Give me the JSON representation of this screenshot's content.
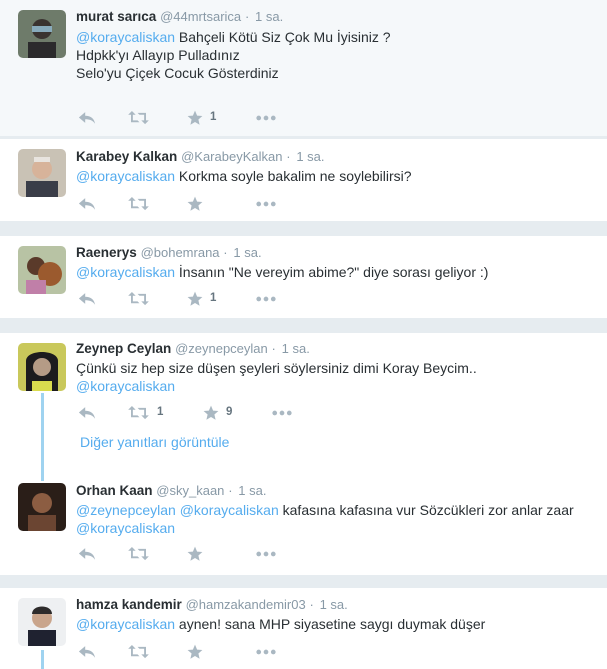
{
  "tweets": [
    {
      "name": "murat sarıca",
      "handle": "@44mrtsarica",
      "time": "1 sa.",
      "lines": [
        {
          "mention": "@koraycaliskan",
          "text": "  Bahçeli Kötü Siz Çok Mu İyisiniz ?"
        },
        {
          "mention": "",
          "text": "Hdpkk'yı Allayıp Pulladınız"
        },
        {
          "mention": "",
          "text": "Selo'yu Çiçek Cocuk Gösterdiniz"
        }
      ],
      "favorites": "1",
      "retweets": ""
    },
    {
      "name": "Karabey Kalkan",
      "handle": "@KarabeyKalkan",
      "time": "1 sa.",
      "lines": [
        {
          "mention": "@koraycaliskan",
          "text": " Korkma soyle bakalim ne soylebilirsi?"
        }
      ],
      "favorites": "",
      "retweets": ""
    },
    {
      "name": "Raenerys",
      "handle": "@bohemrana",
      "time": "1 sa.",
      "lines": [
        {
          "mention": "@koraycaliskan",
          "text": " İnsanın \"Ne vereyim abime?\" diye sorası geliyor :)"
        }
      ],
      "favorites": "1",
      "retweets": ""
    },
    {
      "name": "Zeynep Ceylan",
      "handle": "@zeynepceylan",
      "time": "1 sa.",
      "lines": [
        {
          "mention": "",
          "text": "Çünkü siz hep size düşen şeyleri söylersiniz dimi Koray Beycim.."
        },
        {
          "mention": "@koraycaliskan",
          "text": ""
        }
      ],
      "favorites": "9",
      "retweets": "1"
    },
    {
      "name": "Orhan Kaan",
      "handle": "@sky_kaan",
      "time": "1 sa.",
      "lines": [
        {
          "mention": "@zeynepceylan @koraycaliskan",
          "text": " kafasına kafasına vur Sözcükleri zor anlar zaar"
        },
        {
          "mention": "@koraycaliskan",
          "text": ""
        }
      ],
      "favorites": "",
      "retweets": ""
    },
    {
      "name": "hamza kandemir",
      "handle": "@hamzakandemir03",
      "time": "1 sa.",
      "lines": [
        {
          "mention": "@koraycaliskan",
          "text": " aynen! sana MHP siyasetine saygı duymak düşer"
        }
      ],
      "favorites": "",
      "retweets": ""
    }
  ],
  "thread": {
    "more_replies_label": "Diğer yanıtları görüntüle"
  },
  "icons": {
    "reply": "reply-icon",
    "retweet": "retweet-icon",
    "favorite": "star-icon",
    "more": "more-icon"
  },
  "colors": {
    "link": "#55acee",
    "muted": "#8899a6",
    "icon": "#aab8c2",
    "thread": "#9fd3f0",
    "background": "#e6ecf0"
  }
}
